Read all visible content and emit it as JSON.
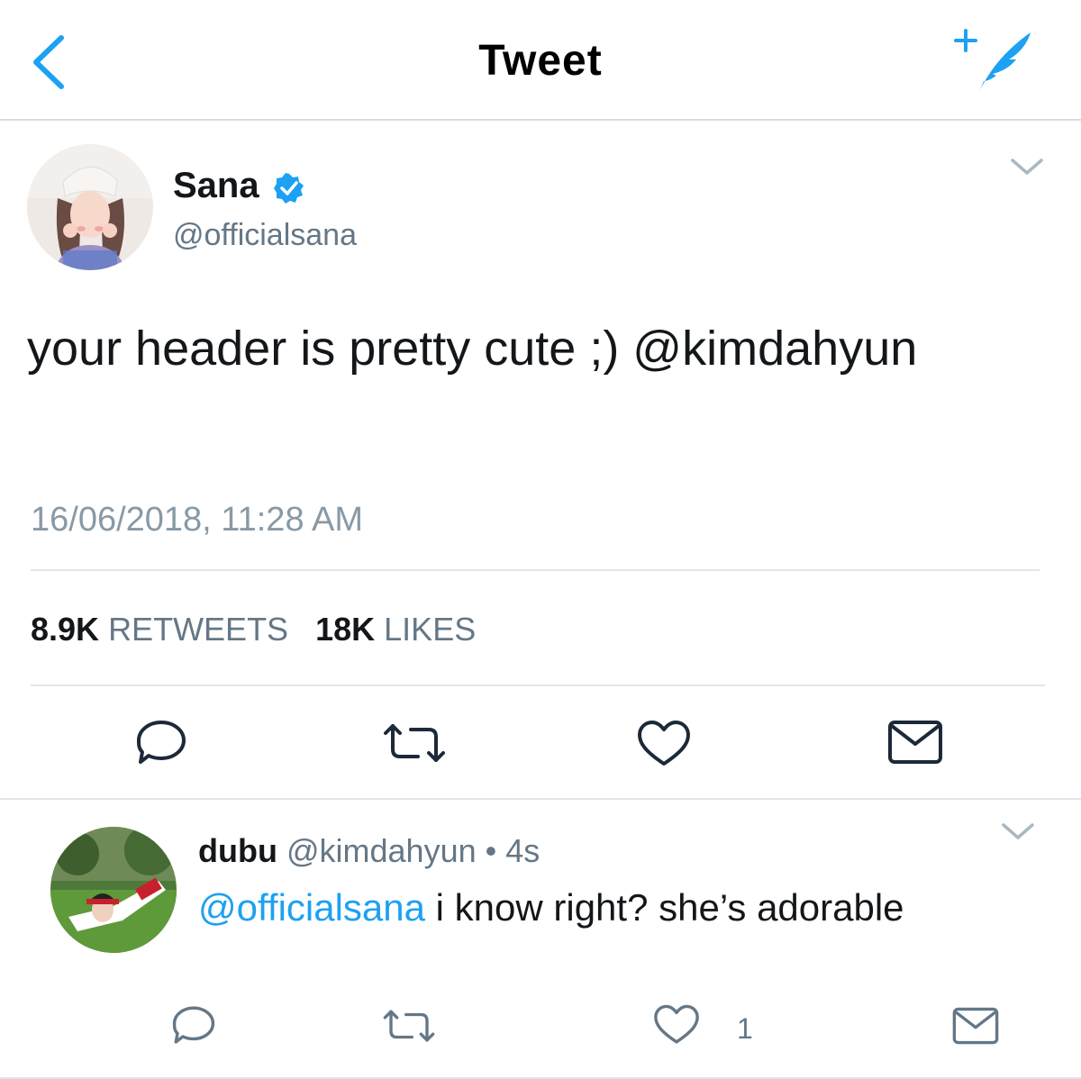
{
  "header": {
    "title": "Tweet",
    "back_icon": "chevron-left-icon",
    "compose_icon": "compose-tweet-icon"
  },
  "colors": {
    "accent": "#1da1f2",
    "muted": "#657786",
    "divider": "#e1e6ea",
    "icon": "#657786"
  },
  "tweet": {
    "name": "Sana",
    "handle": "@officialsana",
    "text": "your header is pretty cute ;) @kimdahyun",
    "timestamp": "16/06/2018, 11:28 AM",
    "retweets_count": "8.9K",
    "retweets_label": "RETWEETS",
    "likes_count": "18K",
    "likes_label": "LIKES"
  },
  "reply": {
    "name": "dubu",
    "handle": "@kimdahyun",
    "separator": "•",
    "time": "4s",
    "mention": "@officialsana",
    "text": " i know right? she’s adorable",
    "like_count": "1"
  }
}
